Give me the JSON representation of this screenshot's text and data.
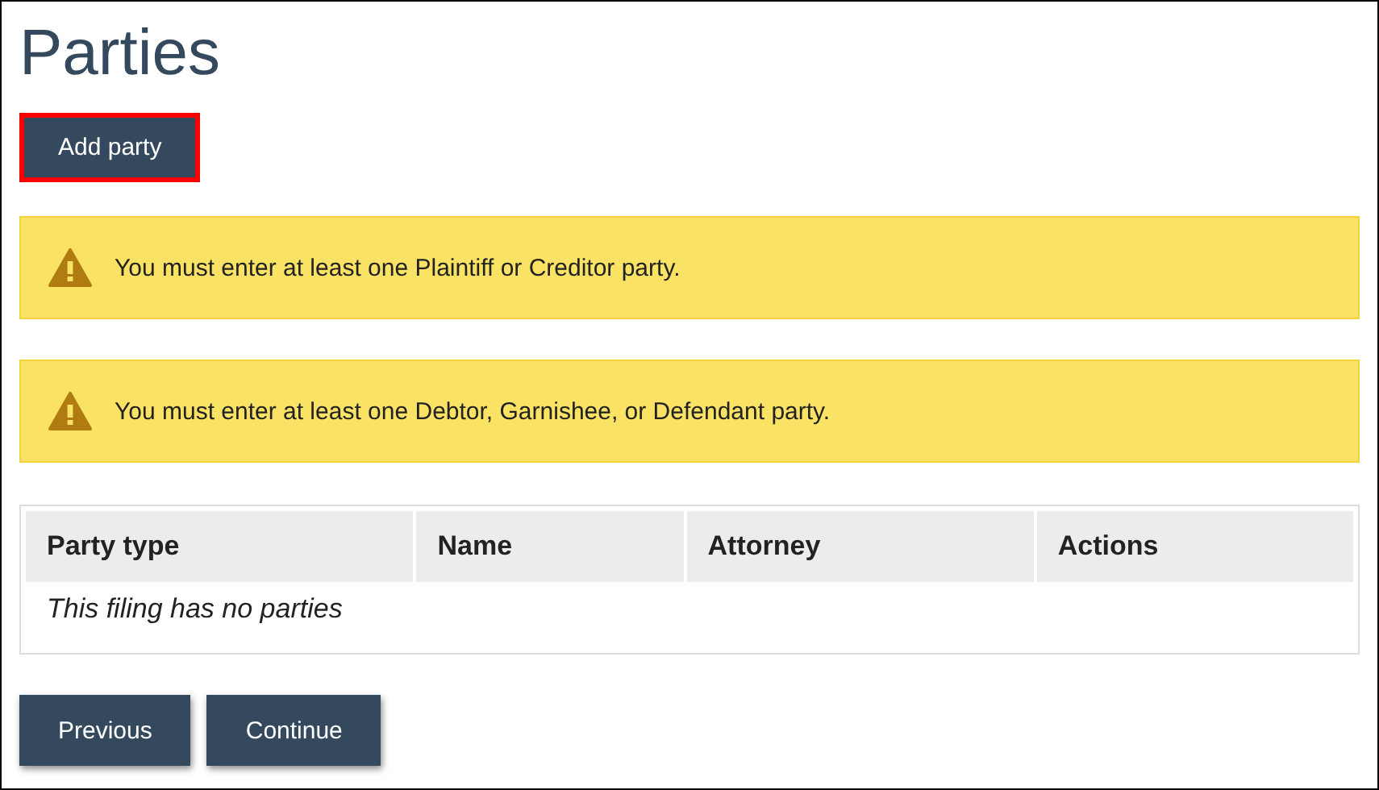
{
  "page": {
    "title": "Parties"
  },
  "add_button": {
    "label": "Add party",
    "highlighted": true
  },
  "alerts": [
    {
      "kind": "warning",
      "text": "You must enter at least one Plaintiff or Creditor party."
    },
    {
      "kind": "warning",
      "text": "You must enter at least one Debtor, Garnishee, or Defendant party."
    }
  ],
  "table": {
    "columns": [
      "Party type",
      "Name",
      "Attorney",
      "Actions"
    ],
    "empty_message": "This filing has no parties"
  },
  "buttons": [
    "Previous",
    "Continue"
  ]
}
